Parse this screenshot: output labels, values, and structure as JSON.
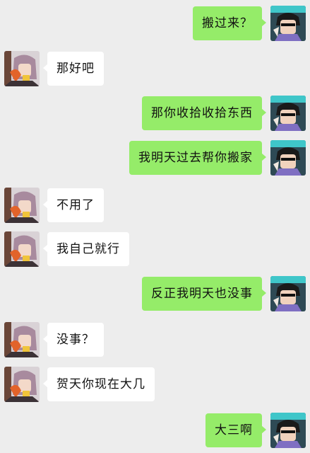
{
  "colors": {
    "background": "#ededed",
    "incoming_bubble": "#ffffff",
    "outgoing_bubble": "#95ec69"
  },
  "icons": {
    "incoming_avatar": "friend-avatar-icon",
    "outgoing_avatar": "self-avatar-icon"
  },
  "messages": [
    {
      "side": "right",
      "text": "搬过来？"
    },
    {
      "side": "left",
      "text": "那好吧"
    },
    {
      "side": "right",
      "text": "那你收拾收拾东西"
    },
    {
      "side": "right",
      "text": "我明天过去帮你搬家"
    },
    {
      "side": "left",
      "text": "不用了"
    },
    {
      "side": "left",
      "text": "我自己就行"
    },
    {
      "side": "right",
      "text": "反正我明天也没事"
    },
    {
      "side": "left",
      "text": "没事？"
    },
    {
      "side": "left",
      "text": "贺天你现在大几"
    },
    {
      "side": "right",
      "text": "大三啊"
    }
  ]
}
